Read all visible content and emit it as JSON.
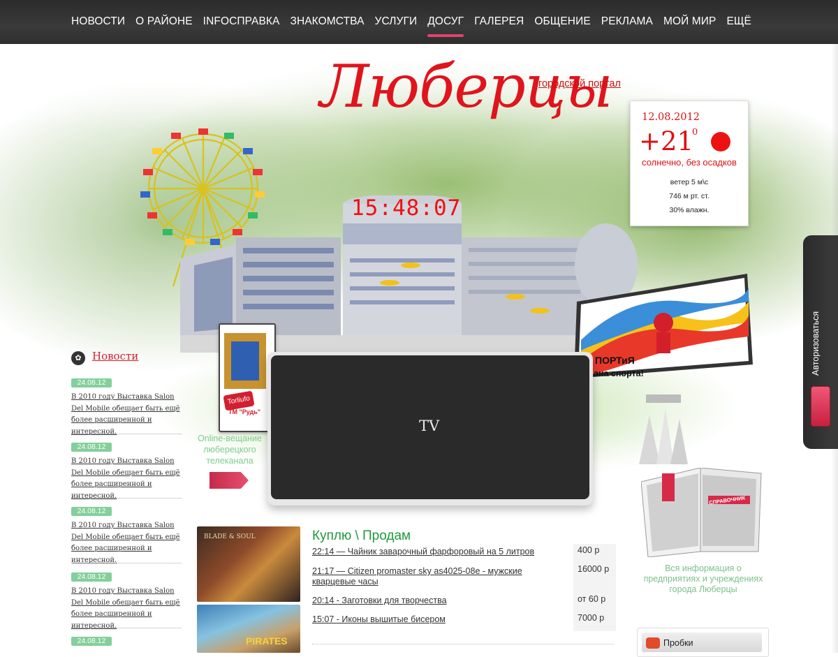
{
  "nav": {
    "items": [
      "НОВОСТИ",
      "О РАЙОНЕ",
      "INFOСПРАВКА",
      "ЗНАКОМСТВА",
      "УСЛУГИ",
      "ДОСУГ",
      "ГАЛЕРЕЯ",
      "ОБЩЕНИЕ",
      "РЕКЛАМА",
      "МОЙ МИР",
      "ЕЩЁ"
    ],
    "active": "ДОСУГ"
  },
  "header": {
    "portal_link": "городской портал",
    "title": "Люберцы",
    "clock": "15:48:07"
  },
  "weather": {
    "date": "12.08.2012",
    "temp": "+21",
    "deg": "0",
    "condition": "солнечно, без осадков",
    "wind": "ветер 5 м\\с",
    "pressure": "746 м рт. ст.",
    "humidity": "30% влажн."
  },
  "billboard": {
    "brand": "ПОРТиЯ",
    "slogan": "ана спорта!"
  },
  "auth": {
    "label": "Авторизоваться"
  },
  "poster": {
    "brand": "Torliufo",
    "sub": "ТМ \"Рудь\""
  },
  "online": {
    "text": "Online-вещание люберецкого телеканала"
  },
  "tv": {
    "label": "TV"
  },
  "directory": {
    "book_label": "СПРАВОЧНИК",
    "caption": "Вся информация о предприятиях и учреждениях города Люберцы"
  },
  "news": {
    "heading": "Новости",
    "items": [
      {
        "date": "24.08.12",
        "text": "В 2010 году Выставка Salon Del Mobile обещает быть ещё более расширенной и интересной."
      },
      {
        "date": "24.08.12",
        "text": "В 2010 году Выставка Salon Del Mobile обещает быть ещё более расширенной и интересной."
      },
      {
        "date": "24.08.12",
        "text": "В 2010 году Выставка Salon Del Mobile обещает быть ещё более расширенной и интересной."
      },
      {
        "date": "24.08.12",
        "text": "В 2010 году Выставка Salon Del Mobile обещает быть ещё более расширенной и интересной."
      },
      {
        "date": "24.08.12",
        "text": ""
      }
    ]
  },
  "games": {
    "thumb1_label": "BLADE & SOUL",
    "thumb2_label": "PIRATES"
  },
  "market": {
    "title": "Куплю \\ Продам",
    "items": [
      {
        "text": "22:14 — Чайник заварочный фарфоровый на 5 литров",
        "price": "400 р"
      },
      {
        "text": "21:17 — Citizen promaster sky as4025-08e - мужские кварцевые часы",
        "price": "16000 р"
      },
      {
        "text": "20:14 - Заготовки для творчества",
        "price": "от 60 р"
      },
      {
        "text": "15:07 - Иконы вышитые бисером",
        "price": "7000 р"
      }
    ]
  },
  "traffic": {
    "label": "Пробки"
  },
  "colors": {
    "nav_bg": "#2e2e2e",
    "accent_red": "#e0141c",
    "accent_pink": "#e0456b",
    "green_text": "#1d9a3c",
    "date_badge": "#85cf9a"
  }
}
